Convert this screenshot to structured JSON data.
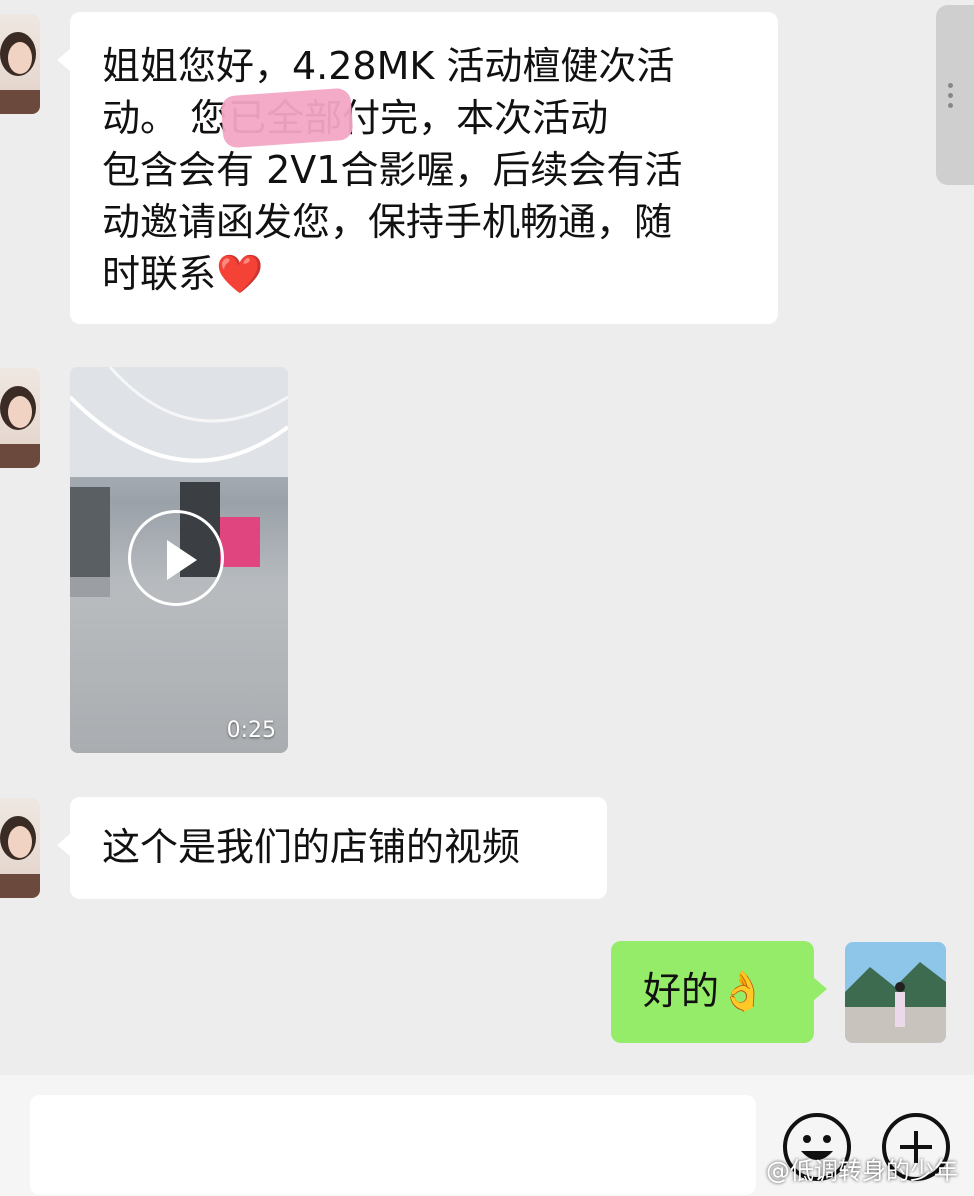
{
  "messages": [
    {
      "sender": "other",
      "type": "text",
      "text_lines": [
        "姐姐您好，4.28MK 活动檀健次活",
        "动。        您已全部付完，本次活动",
        "包含会有 2V1合影喔，后续会有活",
        "动邀请函发您，保持手机畅通，随",
        "时联系❤️"
      ]
    },
    {
      "sender": "other",
      "type": "video",
      "duration": "0:25"
    },
    {
      "sender": "other",
      "type": "text",
      "text": "这个是我们的店铺的视频"
    },
    {
      "sender": "me",
      "type": "text",
      "text": "好的👌"
    }
  ],
  "input": {
    "placeholder": ""
  },
  "watermark": "@低调转身的少年"
}
